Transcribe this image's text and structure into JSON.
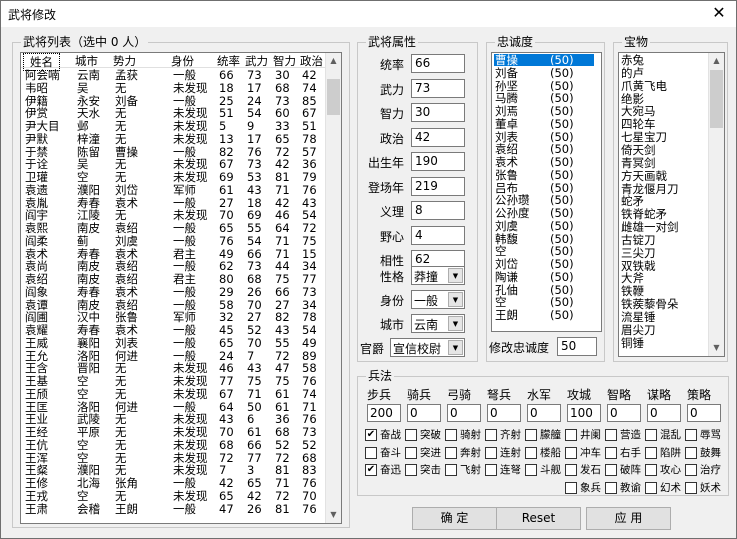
{
  "window": {
    "title": "武将修改",
    "close_glyph": "✕"
  },
  "general_list": {
    "group_label": "武将列表（选中 0 人）",
    "columns": [
      "姓名",
      "城市",
      "势力",
      "身份",
      "统率",
      "武力",
      "智力",
      "政治"
    ],
    "rows": [
      [
        "阿会喃",
        "云南",
        "孟获",
        "一般",
        "66",
        "73",
        "30",
        "42"
      ],
      [
        "韦昭",
        "吴",
        "无",
        "未发现",
        "18",
        "17",
        "68",
        "74"
      ],
      [
        "伊籍",
        "永安",
        "刘备",
        "一般",
        "25",
        "24",
        "73",
        "85"
      ],
      [
        "伊赏",
        "天水",
        "无",
        "未发现",
        "51",
        "54",
        "60",
        "67"
      ],
      [
        "尹大目",
        "邺",
        "无",
        "未发现",
        "5",
        "9",
        "33",
        "51"
      ],
      [
        "尹默",
        "梓潼",
        "无",
        "未发现",
        "13",
        "17",
        "65",
        "78"
      ],
      [
        "于禁",
        "陈留",
        "曹操",
        "一般",
        "82",
        "76",
        "72",
        "57"
      ],
      [
        "于诠",
        "吴",
        "无",
        "未发现",
        "67",
        "73",
        "42",
        "36"
      ],
      [
        "卫瓘",
        "空",
        "无",
        "未发现",
        "69",
        "53",
        "81",
        "79"
      ],
      [
        "袁遗",
        "濮阳",
        "刘岱",
        "军师",
        "61",
        "43",
        "71",
        "76"
      ],
      [
        "袁胤",
        "寿春",
        "袁术",
        "一般",
        "27",
        "18",
        "42",
        "43"
      ],
      [
        "阎宇",
        "江陵",
        "无",
        "未发现",
        "70",
        "69",
        "46",
        "54"
      ],
      [
        "袁熙",
        "南皮",
        "袁绍",
        "一般",
        "65",
        "55",
        "64",
        "72"
      ],
      [
        "阎柔",
        "蓟",
        "刘虞",
        "一般",
        "76",
        "54",
        "71",
        "75"
      ],
      [
        "袁术",
        "寿春",
        "袁术",
        "君主",
        "49",
        "66",
        "71",
        "15"
      ],
      [
        "袁尚",
        "南皮",
        "袁绍",
        "一般",
        "62",
        "73",
        "44",
        "34"
      ],
      [
        "袁绍",
        "南皮",
        "袁绍",
        "君主",
        "80",
        "68",
        "75",
        "77"
      ],
      [
        "阎象",
        "寿春",
        "袁术",
        "一般",
        "29",
        "26",
        "66",
        "73"
      ],
      [
        "袁谭",
        "南皮",
        "袁绍",
        "一般",
        "58",
        "70",
        "27",
        "34"
      ],
      [
        "阎圃",
        "汉中",
        "张鲁",
        "军师",
        "32",
        "27",
        "82",
        "78"
      ],
      [
        "袁耀",
        "寿春",
        "袁术",
        "一般",
        "45",
        "52",
        "43",
        "54"
      ],
      [
        "王威",
        "襄阳",
        "刘表",
        "一般",
        "65",
        "70",
        "55",
        "49"
      ],
      [
        "王允",
        "洛阳",
        "何进",
        "一般",
        "24",
        "7",
        "72",
        "89"
      ],
      [
        "王含",
        "晋阳",
        "无",
        "未发现",
        "46",
        "43",
        "47",
        "58"
      ],
      [
        "王基",
        "空",
        "无",
        "未发现",
        "77",
        "75",
        "75",
        "76"
      ],
      [
        "王颀",
        "空",
        "无",
        "未发现",
        "67",
        "71",
        "61",
        "74"
      ],
      [
        "王匡",
        "洛阳",
        "何进",
        "一般",
        "64",
        "50",
        "61",
        "71"
      ],
      [
        "王业",
        "武陵",
        "无",
        "未发现",
        "43",
        "6",
        "36",
        "76"
      ],
      [
        "王经",
        "平原",
        "无",
        "未发现",
        "70",
        "61",
        "68",
        "73"
      ],
      [
        "王伉",
        "空",
        "无",
        "未发现",
        "68",
        "66",
        "52",
        "52"
      ],
      [
        "王浑",
        "空",
        "无",
        "未发现",
        "72",
        "77",
        "72",
        "68"
      ],
      [
        "王粲",
        "濮阳",
        "无",
        "未发现",
        "7",
        "3",
        "81",
        "83"
      ],
      [
        "王修",
        "北海",
        "张角",
        "一般",
        "42",
        "65",
        "71",
        "76"
      ],
      [
        "王戎",
        "空",
        "无",
        "未发现",
        "65",
        "42",
        "72",
        "70"
      ],
      [
        "王肃",
        "会稽",
        "王朗",
        "一般",
        "47",
        "26",
        "81",
        "76"
      ]
    ]
  },
  "attributes": {
    "group_label": "武将属性",
    "fields": [
      {
        "label": "统率",
        "value": "66"
      },
      {
        "label": "武力",
        "value": "73"
      },
      {
        "label": "智力",
        "value": "30"
      },
      {
        "label": "政治",
        "value": "42"
      },
      {
        "label": "出生年",
        "value": "190"
      },
      {
        "label": "登场年",
        "value": "219"
      },
      {
        "label": "义理",
        "value": "8"
      },
      {
        "label": "野心",
        "value": "4"
      },
      {
        "label": "相性",
        "value": "62"
      }
    ],
    "dropdowns": [
      {
        "label": "性格",
        "value": "莽撞"
      },
      {
        "label": "身份",
        "value": "一般"
      },
      {
        "label": "城市",
        "value": "云南"
      },
      {
        "label": "官爵",
        "value": "宣信校尉"
      }
    ]
  },
  "loyalty": {
    "group_label": "忠诚度",
    "items": [
      {
        "name": "曹操",
        "value": "(50)"
      },
      {
        "name": "刘备",
        "value": "(50)"
      },
      {
        "name": "孙坚",
        "value": "(50)"
      },
      {
        "name": "马腾",
        "value": "(50)"
      },
      {
        "name": "刘焉",
        "value": "(50)"
      },
      {
        "name": "董卓",
        "value": "(50)"
      },
      {
        "name": "刘表",
        "value": "(50)"
      },
      {
        "name": "袁绍",
        "value": "(50)"
      },
      {
        "name": "袁术",
        "value": "(50)"
      },
      {
        "name": "张鲁",
        "value": "(50)"
      },
      {
        "name": "吕布",
        "value": "(50)"
      },
      {
        "name": "公孙瓒",
        "value": "(50)"
      },
      {
        "name": "公孙度",
        "value": "(50)"
      },
      {
        "name": "刘虞",
        "value": "(50)"
      },
      {
        "name": "韩馥",
        "value": "(50)"
      },
      {
        "name": "空",
        "value": "(50)"
      },
      {
        "name": "刘岱",
        "value": "(50)"
      },
      {
        "name": "陶谦",
        "value": "(50)"
      },
      {
        "name": "孔伷",
        "value": "(50)"
      },
      {
        "name": "空",
        "value": "(50)"
      },
      {
        "name": "王朗",
        "value": "(50)"
      }
    ],
    "modify_label": "修改忠诚度",
    "modify_value": "50"
  },
  "treasures": {
    "group_label": "宝物",
    "items": [
      "赤兔",
      "的卢",
      "爪黄飞电",
      "绝影",
      "大宛马",
      "四轮车",
      "七星宝刀",
      "倚天剑",
      "青冥剑",
      "方天画戟",
      "青龙偃月刀",
      "蛇矛",
      "铁脊蛇矛",
      "雌雄一对剑",
      "古锭刀",
      "三尖刀",
      "双铁戟",
      "大斧",
      "铁鞭",
      "铁蒺藜骨朵",
      "流星锤",
      "眉尖刀",
      "铜锤"
    ]
  },
  "troops": {
    "group_label": "兵法",
    "headers": [
      "步兵",
      "骑兵",
      "弓骑",
      "弩兵",
      "水军",
      "攻城",
      "智略",
      "谋略",
      "策略"
    ],
    "values": [
      "200",
      "0",
      "0",
      "0",
      "0",
      "100",
      "0",
      "0",
      "0"
    ],
    "skills": [
      [
        "奋战",
        "突破",
        "骑射",
        "齐射",
        "朦艟",
        "井阑",
        "营造",
        "混乱",
        "辱骂"
      ],
      [
        "奋斗",
        "突进",
        "奔射",
        "连射",
        "楼船",
        "冲车",
        "右手",
        "陷阱",
        "鼓舞"
      ],
      [
        "奋迅",
        "突击",
        "飞射",
        "连弩",
        "斗舰",
        "发石",
        "破阵",
        "攻心",
        "治疗"
      ],
      [
        "象兵",
        "教谕",
        "幻术",
        "妖术"
      ]
    ],
    "checked": [
      "奋战",
      "奋迅"
    ]
  },
  "buttons": {
    "ok": "确 定",
    "reset": "Reset",
    "apply": "应 用"
  }
}
